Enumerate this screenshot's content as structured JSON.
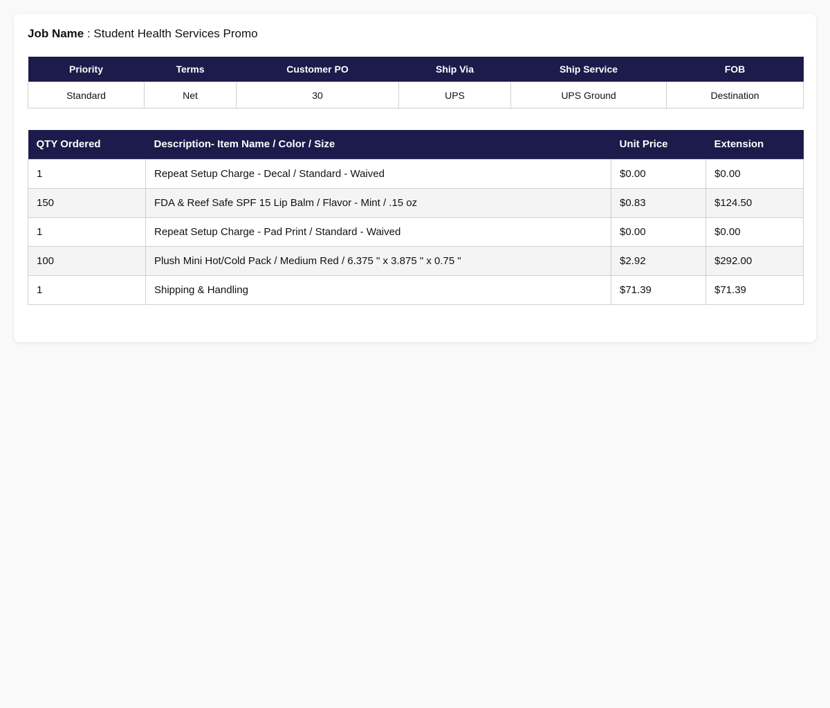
{
  "job": {
    "label": "Job Name",
    "separator": " : ",
    "value": "Student Health Services Promo"
  },
  "order_info": {
    "headers": [
      "Priority",
      "Terms",
      "Customer PO",
      "Ship Via",
      "Ship Service",
      "FOB"
    ],
    "values": [
      "Standard",
      "Net",
      "30",
      "UPS",
      "UPS Ground",
      "Destination"
    ]
  },
  "items": {
    "headers": [
      "QTY Ordered",
      "Description- Item Name / Color / Size",
      "Unit Price",
      "Extension"
    ],
    "rows": [
      {
        "qty": "1",
        "description": "Repeat Setup Charge - Decal / Standard - Waived",
        "unit_price": "$0.00",
        "extension": "$0.00"
      },
      {
        "qty": "150",
        "description": "FDA & Reef Safe SPF 15 Lip Balm / Flavor - Mint / .15 oz",
        "unit_price": "$0.83",
        "extension": "$124.50"
      },
      {
        "qty": "1",
        "description": "Repeat Setup Charge - Pad Print / Standard - Waived",
        "unit_price": "$0.00",
        "extension": "$0.00"
      },
      {
        "qty": "100",
        "description": "Plush Mini Hot/Cold Pack / Medium Red / 6.375 \" x 3.875 \" x 0.75 \"",
        "unit_price": "$2.92",
        "extension": "$292.00"
      },
      {
        "qty": "1",
        "description": "Shipping & Handling",
        "unit_price": "$71.39",
        "extension": "$71.39"
      }
    ]
  },
  "colors": {
    "header_bg": "#1c1b4b",
    "page_bg": "#f9f9f9",
    "card_bg": "#ffffff",
    "alt_row_bg": "#f4f4f4"
  }
}
